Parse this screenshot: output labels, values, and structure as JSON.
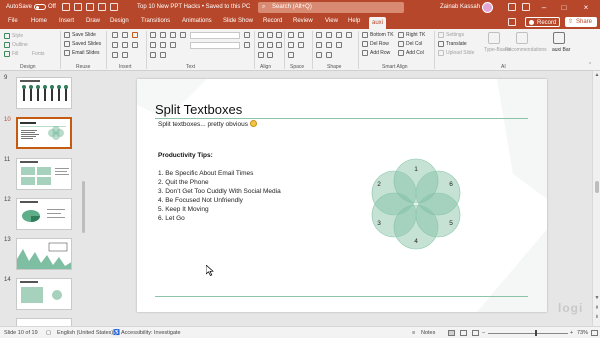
{
  "titlebar": {
    "autosave_label": "AutoSave",
    "autosave_state": "Off",
    "document_title": "Top 10 New PPT Hacks • Saved to this PC",
    "search_placeholder": "Search (Alt+Q)",
    "user_name": "Zainab Kassah",
    "accent_color": "#b7472a"
  },
  "tabs": [
    "File",
    "Home",
    "Insert",
    "Draw",
    "Design",
    "Transitions",
    "Animations",
    "Slide Show",
    "Record",
    "Review",
    "View",
    "Help",
    "auxi"
  ],
  "active_tab": "auxi",
  "record_button": "Record",
  "share_button": "Share",
  "ribbon": {
    "design": {
      "label": "Design",
      "items": [
        "Style",
        "Outline",
        "Fill",
        "Fonts"
      ]
    },
    "reuse": {
      "label": "Reuse",
      "items": [
        "Save Slide",
        "Saved Slides",
        "Email Slides"
      ]
    },
    "insert": {
      "label": "Insert"
    },
    "text": {
      "label": "Text"
    },
    "align": {
      "label": "Align"
    },
    "space": {
      "label": "Space"
    },
    "shape": {
      "label": "Shape"
    },
    "smart_align": {
      "label": "Smart Align",
      "items": [
        "Bottom TK",
        "Right TK",
        "Del Row",
        "Del Col",
        "Add Row",
        "Add Col"
      ]
    },
    "ai": {
      "label": "AI",
      "items": [
        "Settings",
        "Translate",
        "Upload Slide",
        "Type-Based",
        "Recommendations",
        "auxi Bar"
      ]
    }
  },
  "thumbnails": {
    "numbers": [
      "9",
      "10",
      "11",
      "12",
      "13",
      "14"
    ],
    "selected": "10"
  },
  "slide": {
    "title": "Split Textboxes",
    "subtitle": "Split textboxes... pretty obvious",
    "list_heading": "Productivity Tips:",
    "items": [
      "1. Be Specific About Email Times",
      "2. Quit the Phone",
      "3. Don’t Get Too Cuddly With Social Media",
      "4. Be Focused Not Unfriendly",
      "5. Keep It Moving",
      "6. Let Go"
    ],
    "diagram_numbers": [
      "1",
      "6",
      "5",
      "4",
      "3",
      "2"
    ],
    "petal_color": "#7ebea2",
    "rule_color": "#8bc5a8"
  },
  "watermark": "logi",
  "status": {
    "slide_info": "Slide 10 of 19",
    "language": "English (United States)",
    "accessibility": "Accessibility: Investigate",
    "notes": "Notes",
    "zoom": "73%"
  }
}
